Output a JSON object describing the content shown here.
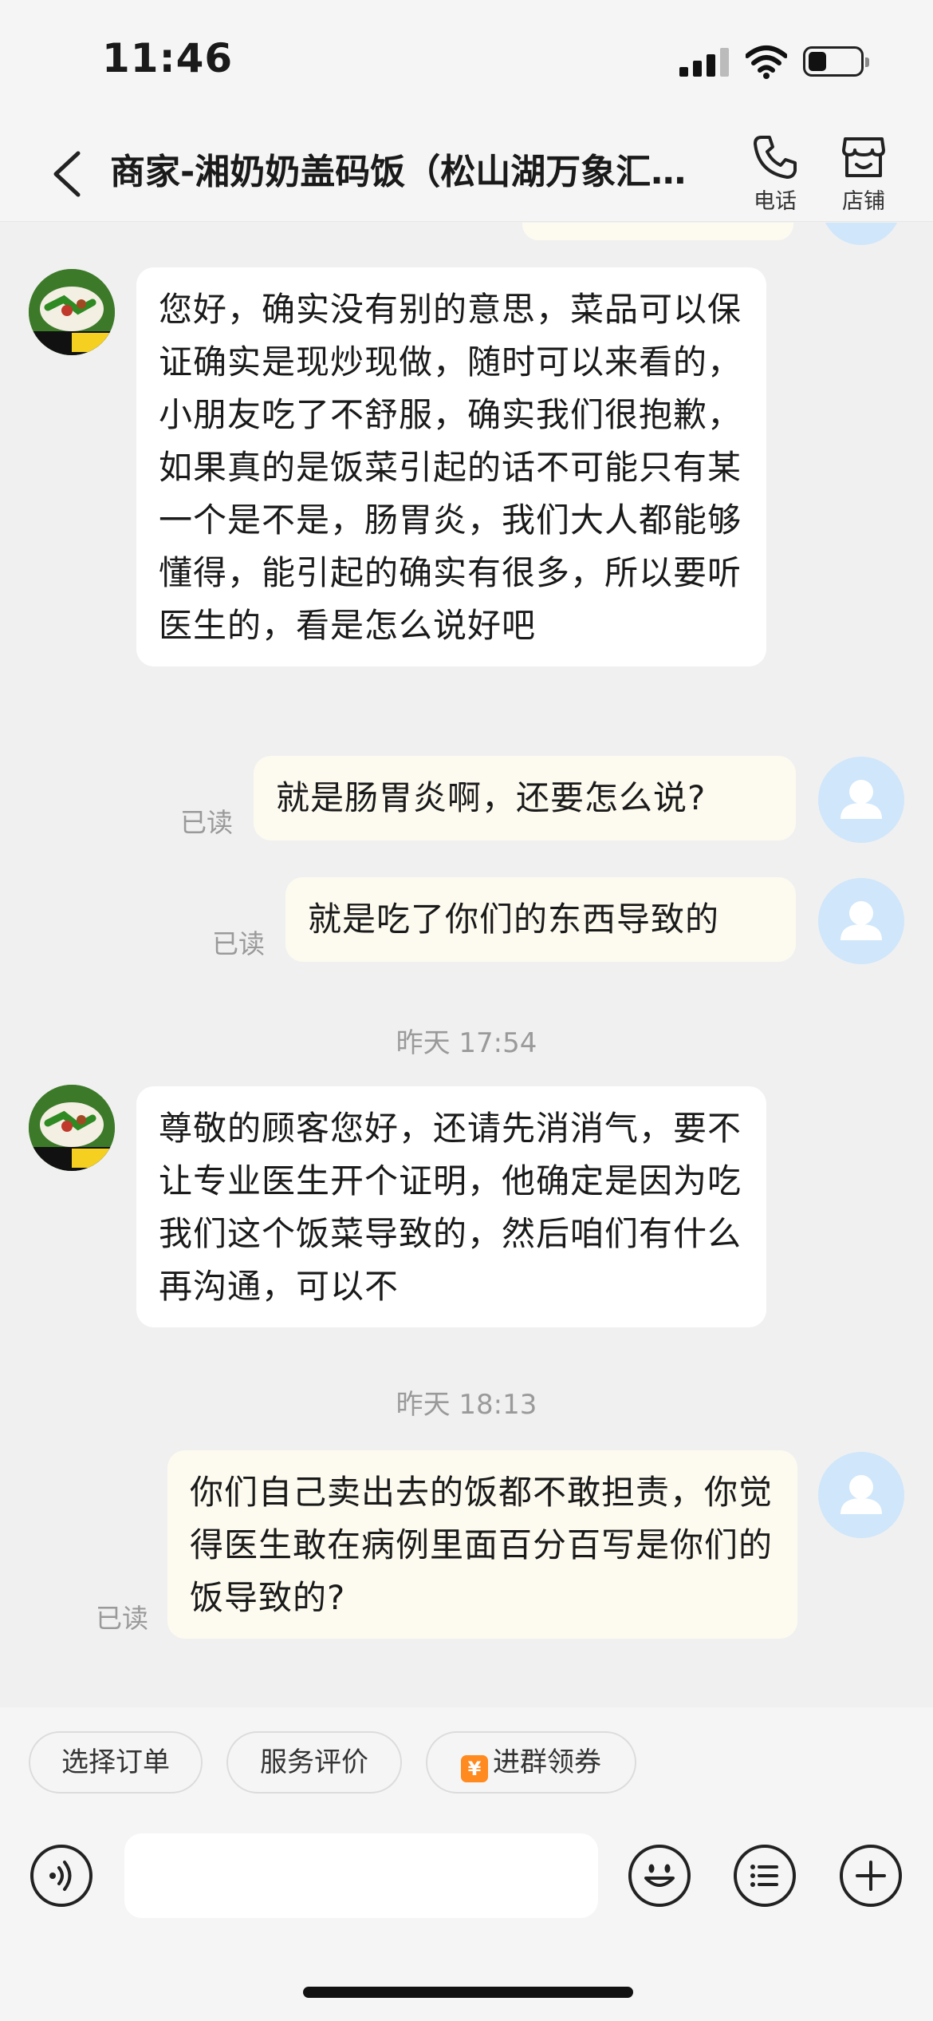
{
  "status_bar": {
    "time": "11:46"
  },
  "header": {
    "title": "商家-湘奶奶盖码饭（松山湖万象汇…",
    "phone_label": "电话",
    "shop_label": "店铺"
  },
  "messages": [
    {
      "side": "left",
      "text": "您好，确实没有别的意思，菜品可以保证确实是现炒现做，随时可以来看的，小朋友吃了不舒服，确实我们很抱歉，如果真的是饭菜引起的话不可能只有某一个是不是，肠胃炎，我们大人都能够懂得，能引起的确实有很多，所以要听医生的，看是怎么说好吧"
    },
    {
      "side": "right",
      "text": "就是肠胃炎啊，还要怎么说?",
      "status": "已读"
    },
    {
      "side": "right",
      "text": "就是吃了你们的东西导致的",
      "status": "已读"
    },
    {
      "timestamp": "昨天 17:54"
    },
    {
      "side": "left",
      "text": "尊敬的顾客您好，还请先消消气，要不让专业医生开个证明，他确定是因为吃我们这个饭菜导致的，然后咱们有什么再沟通，可以不"
    },
    {
      "timestamp": "昨天 18:13"
    },
    {
      "side": "right",
      "text": "你们自己卖出去的饭都不敢担责，你觉得医生敢在病例里面百分百写是你们的饭导致的?",
      "status": "已读"
    }
  ],
  "quick_actions": [
    "选择订单",
    "服务评价",
    "进群领券"
  ],
  "gift_glyph": "¥"
}
